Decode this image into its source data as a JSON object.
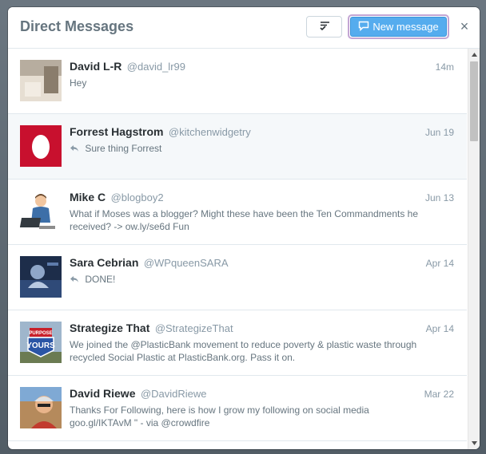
{
  "modal": {
    "title": "Direct Messages",
    "new_message_label": "New message",
    "close_symbol": "×"
  },
  "icons": {
    "mark_read": "mark-all-read-icon",
    "compose": "compose-message-icon",
    "reply": "reply-arrow-icon",
    "close": "close-icon"
  },
  "colors": {
    "accent": "#55acee",
    "title": "#66757f",
    "name": "#292f33",
    "muted": "#8899a6",
    "highlight_row": "#f5f8fa"
  },
  "conversations": [
    {
      "name": "David L-R",
      "handle": "@david_lr99",
      "time": "14m",
      "snippet": "Hey",
      "replied": false
    },
    {
      "name": "Forrest Hagstrom",
      "handle": "@kitchenwidgetry",
      "time": "Jun 19",
      "snippet": "Sure thing Forrest",
      "replied": true
    },
    {
      "name": "Mike C",
      "handle": "@blogboy2",
      "time": "Jun 13",
      "snippet": "What if Moses was a blogger? Might these have been the Ten Commandments he received? -> ow.ly/se6d Fun",
      "replied": false
    },
    {
      "name": "Sara Cebrian",
      "handle": "@WPqueenSARA",
      "time": "Apr 14",
      "snippet": "DONE!",
      "replied": true
    },
    {
      "name": "Strategize That",
      "handle": "@StrategizeThat",
      "time": "Apr 14",
      "snippet": "We joined the @PlasticBank movement to reduce poverty & plastic waste through recycled Social Plastic at PlasticBank.org. Pass it on.",
      "replied": false,
      "avatar_text_top": "PURPOSE",
      "avatar_text_main": "YOURS"
    },
    {
      "name": "David Riewe",
      "handle": "@DavidRiewe",
      "time": "Mar 22",
      "snippet": "Thanks For Following, here is how I grow my following on social media goo.gl/IKTAvM \" - via @crowdfire",
      "replied": false
    }
  ]
}
